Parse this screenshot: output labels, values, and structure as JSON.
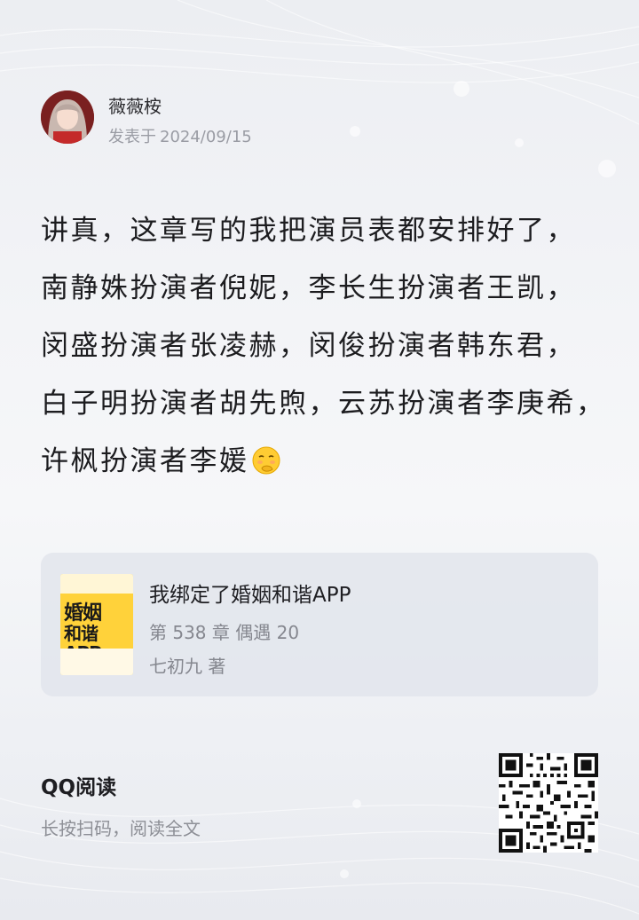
{
  "post": {
    "author": "薇薇桉",
    "date_prefix": "发表于",
    "date": "2024/09/15",
    "avatar_icon": "anime-girl-avatar",
    "content_lines": [
      "讲真，这章写的我把演员表都安排好了，",
      "南静姝扮演者倪妮，李长生扮演者王凯，",
      "闵盛扮演者张凌赫，闵俊扮演者韩东君，",
      "白子明扮演者胡先煦，云苏扮演者李庚希，",
      "许枫扮演者李媛"
    ],
    "emoji": "shy-face-emoji"
  },
  "book": {
    "title": "我绑定了婚姻和谐APP",
    "chapter": "第 538 章 偶遇 20",
    "author": "七初九 著",
    "cover_line1": "婚姻",
    "cover_line2": "和谐APP",
    "cover_color": "#ffd23a"
  },
  "footer": {
    "app_name": "QQ阅读",
    "hint": "长按扫码，阅读全文",
    "qr_icon": "qr-code-icon"
  }
}
